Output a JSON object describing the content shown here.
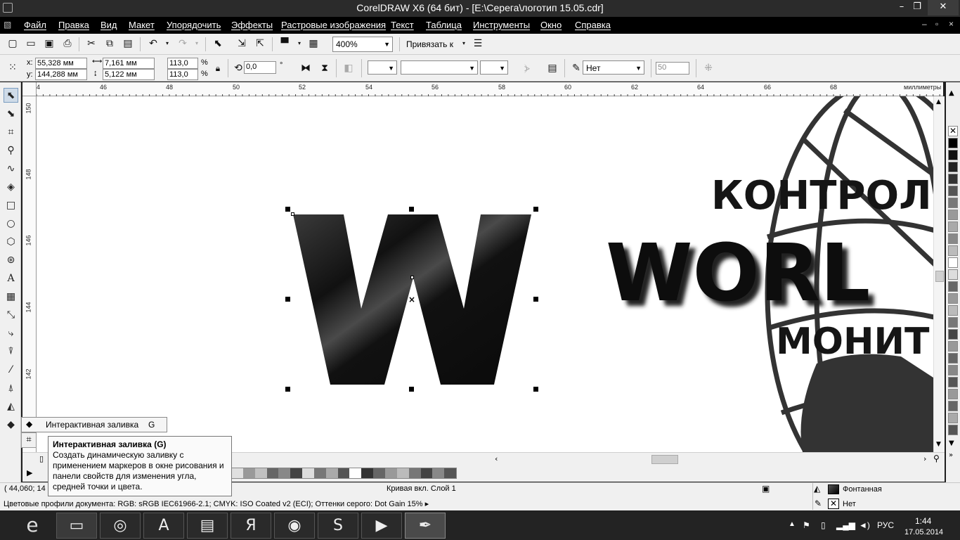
{
  "window": {
    "title": "CorelDRAW X6 (64 бит) - [E:\\Серега\\логотип 15.05.cdr]",
    "minimize_icon": "minimize-icon",
    "restore_icon": "restore-icon",
    "close_icon": "close-icon"
  },
  "menu": {
    "items": [
      "Файл",
      "Правка",
      "Вид",
      "Макет",
      "Упорядочить",
      "Эффекты",
      "Растровые изображения",
      "Текст",
      "Таблица",
      "Инструменты",
      "Окно",
      "Справка"
    ],
    "doc_buttons": [
      "–",
      "▫",
      "×"
    ]
  },
  "toolbar": {
    "zoom_value": "400%",
    "snap_label": "Привязать к"
  },
  "properties": {
    "x_label": "x:",
    "x_value": "55,328 мм",
    "y_label": "y:",
    "y_value": "144,288 мм",
    "width_value": "7,161 мм",
    "height_value": "5,122 мм",
    "scale_x": "113,0",
    "scale_y": "113,0",
    "percent": "%",
    "rotation_value": "0,0",
    "degree": "°",
    "outline_value": "Нет",
    "transparency_value": "50"
  },
  "ruler": {
    "top_ticks": [
      "4",
      "46",
      "48",
      "50",
      "52",
      "54",
      "56",
      "58",
      "60",
      "62",
      "64",
      "66",
      "68"
    ],
    "units": "миллиметры",
    "left_ticks": [
      "150",
      "148",
      "146",
      "144",
      "142"
    ]
  },
  "canvas": {
    "selected_letter": "W",
    "logo_line1": "КОНТРОЛ",
    "logo_line2": "WORL",
    "logo_line3": "МОНИТ"
  },
  "flyout": {
    "item_label": "Интерактивная заливка",
    "item_shortcut": "G"
  },
  "tooltip": {
    "title": "Интерактивная заливка (G)",
    "body": "Создать динамическую заливку с применением маркеров в окне рисования и панели свойств для изменения угла, средней точки и цвета."
  },
  "status": {
    "coords": "( 44,060; 14",
    "object_info": "Кривая вкл. Слой 1",
    "fill_label": "Фонтанная",
    "outline_label": "Нет",
    "color_profiles": "Цветовые профили документа: RGB: sRGB IEC61966-2.1; CMYK: ISO Coated v2 (ECI); Оттенки серого: Dot Gain 15%"
  },
  "tray": {
    "language": "РУС",
    "time": "1:44",
    "date": "17.05.2014"
  },
  "colors": {
    "title_bg": "#2b2b2b",
    "menu_bg": "#000000",
    "taskbar_bg": "#232323",
    "letter_fill": "#0d0d0d"
  }
}
